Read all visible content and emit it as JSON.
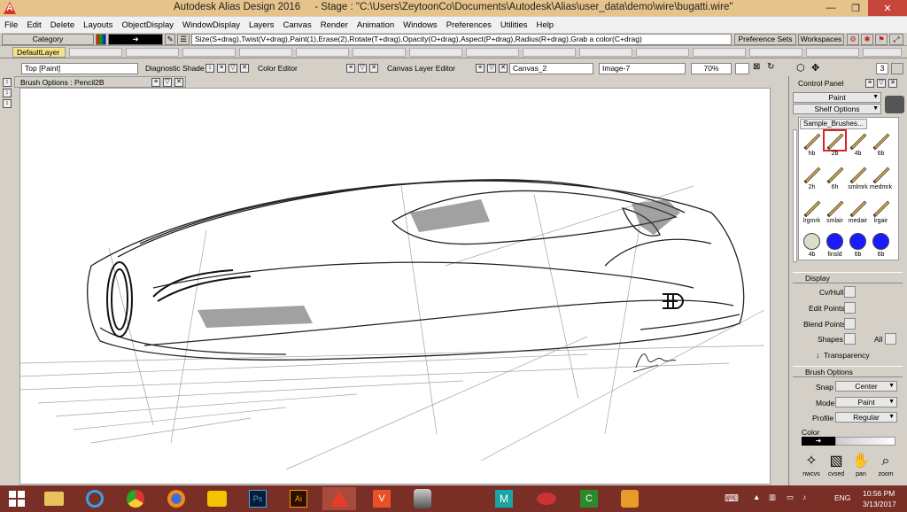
{
  "window": {
    "title": "Autodesk Alias Design 2016",
    "stage": "- Stage : \"C:\\Users\\ZeytoonCo\\Documents\\Autodesk\\Alias\\user_data\\demo\\wire\\bugatti.wire\"",
    "minimize": "—",
    "maximize": "❐",
    "close": "✕"
  },
  "menubar": [
    "File",
    "Edit",
    "Delete",
    "Layouts",
    "ObjectDisplay",
    "WindowDisplay",
    "Layers",
    "Canvas",
    "Render",
    "Animation",
    "Windows",
    "Preferences",
    "Utilities",
    "Help"
  ],
  "toolbar": {
    "category": "Category",
    "hints": "Size(S+drag),Twist(V+drag),Paint(1),Erase(2),Rotate(T+drag),Opacity(O+drag),Aspect(P+drag),Radius(R+drag),Grab a color(C+drag)",
    "preference_sets": "Preference Sets",
    "workspaces": "Workspaces"
  },
  "layers": {
    "current": "DefaultLayer"
  },
  "windows": {
    "view": "Top [Paint]",
    "diagnostic": "Diagnostic Shade",
    "color_editor": "Color Editor",
    "canvas_layer_editor": "Canvas Layer Editor",
    "canvas_name": "Canvas_2",
    "image_name": "Image-7",
    "zoom": "70%",
    "page_number": "3"
  },
  "brush_options_bar": "Brush Options : Pencil2B",
  "control_panel": {
    "title": "Control Panel",
    "mode": "Paint",
    "shelf_options": "Shelf Options",
    "shelf_tab": "Sample_Brushes...",
    "brushes": [
      "hb",
      "2b",
      "4b",
      "6b",
      "2h",
      "6h",
      "smlmrk",
      "medmrk",
      "lrgmrk",
      "smlair",
      "medair",
      "lrgair",
      "4b",
      "finsld",
      "6b",
      "6b"
    ],
    "display": {
      "header": "Display",
      "cv_hull": "Cv/Hull",
      "edit_points": "Edit Points",
      "blend_points": "Blend Points",
      "shapes": "Shapes",
      "all": "All",
      "transparency": "Transparency"
    },
    "brush_options": {
      "header": "Brush Options",
      "snap_label": "Snap",
      "snap_value": "Center",
      "mode_label": "Mode",
      "mode_value": "Paint",
      "profile_label": "Profile",
      "profile_value": "Regular",
      "color_label": "Color"
    },
    "bottom_tools": [
      "nwcvs",
      "cvsed",
      "pan",
      "zoom"
    ]
  },
  "taskbar": {
    "language": "ENG",
    "time": "10:56 PM",
    "date": "3/13/2017"
  },
  "colors": {
    "titlebar": "#e6c38b",
    "taskbar": "#7a2f26",
    "selection": "#dd2222"
  }
}
